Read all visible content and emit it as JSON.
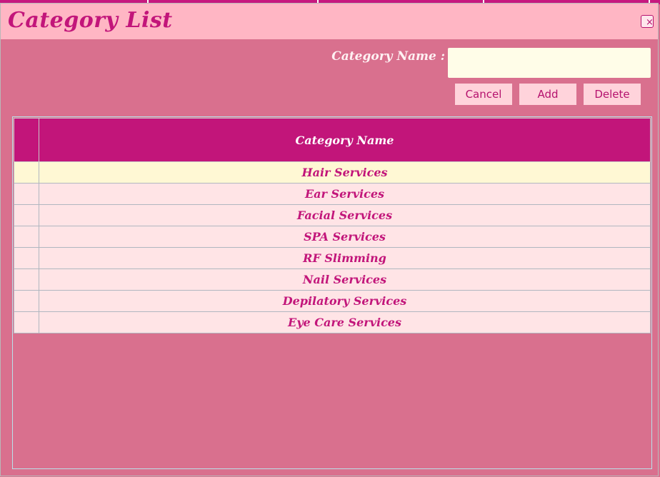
{
  "dialog": {
    "title": "Category List",
    "close_label": "×"
  },
  "form": {
    "label": "Category Name :",
    "input_value": "",
    "input_placeholder": "",
    "cancel_label": "Cancel",
    "add_label": "Add",
    "delete_label": "Delete"
  },
  "table": {
    "column_header": "Category Name",
    "selected_row": 0,
    "rows": [
      "Hair Services",
      "Ear Services",
      "Facial Services",
      "SPA Services",
      "RF Slimming",
      "Nail Services",
      "Depilatory Services",
      "Eye Care Services"
    ]
  },
  "colors": {
    "dialog_bg": "#d9708e",
    "titlebar_bg": "#ffb6c4",
    "accent": "#c2157a",
    "row_bg": "#ffe4e6",
    "selected_row_bg": "#fff8d4",
    "input_bg": "#fffde8"
  }
}
